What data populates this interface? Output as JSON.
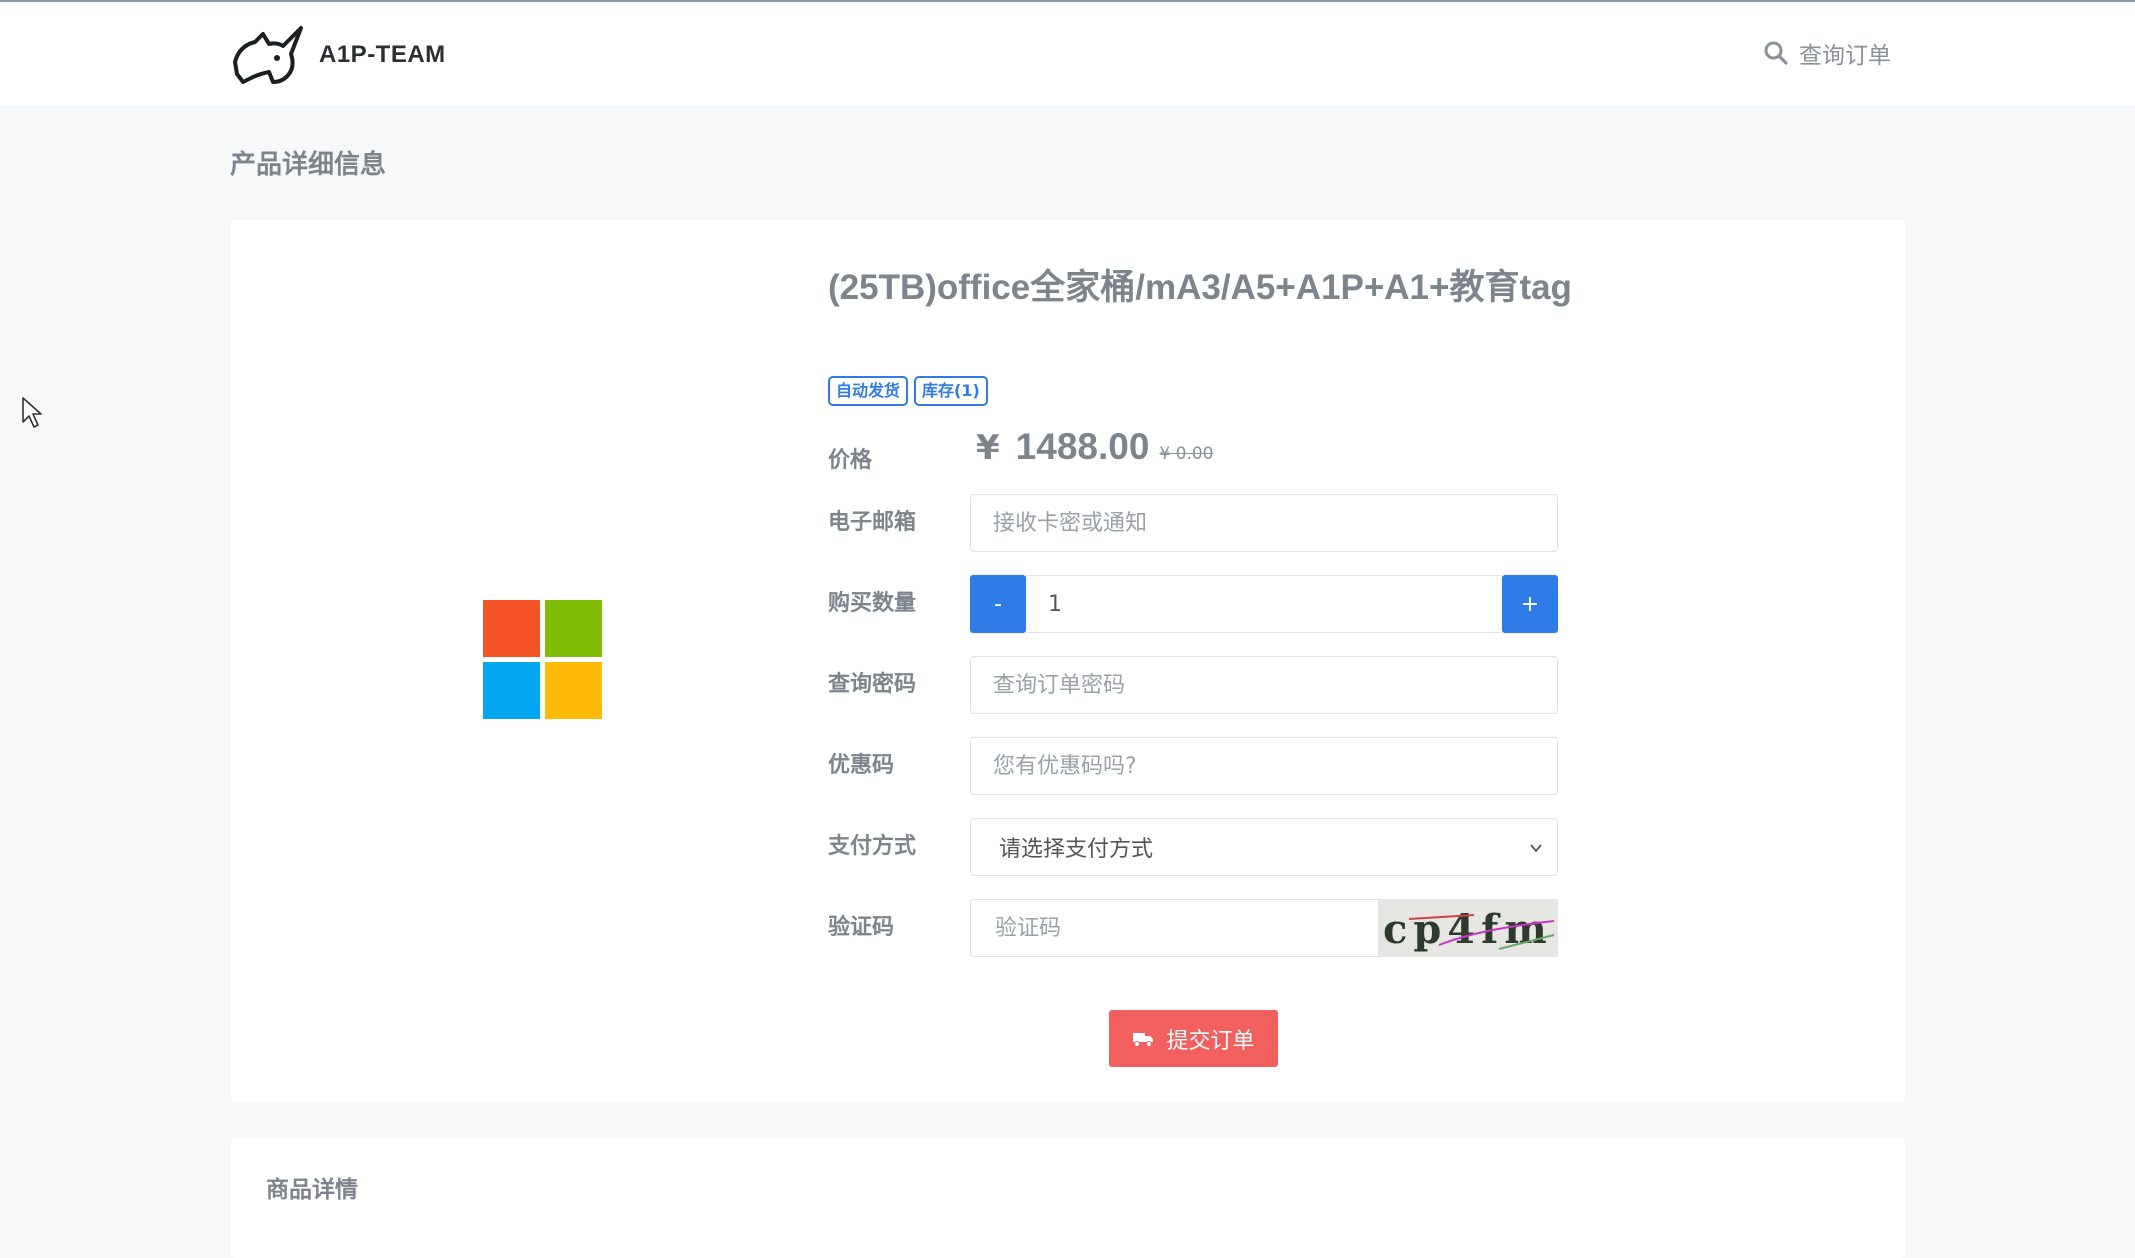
{
  "header": {
    "brand_name": "A1P-TEAM",
    "query_orders_label": "查询订单"
  },
  "page": {
    "heading": "产品详细信息"
  },
  "product": {
    "title": "(25TB)office全家桶/mA3/A5+A1P+A1+教育tag",
    "badges": [
      "自动发货",
      "库存(1)"
    ],
    "image_icon": "microsoft-logo-icon",
    "price_label": "价格",
    "currency": "¥",
    "price": "1488.00",
    "original_price": "¥ 0.00"
  },
  "form": {
    "email_label": "电子邮箱",
    "email_placeholder": "接收卡密或通知",
    "quantity_label": "购买数量",
    "quantity_value": "1",
    "minus": "-",
    "plus": "+",
    "password_label": "查询密码",
    "password_placeholder": "查询订单密码",
    "coupon_label": "优惠码",
    "coupon_placeholder": "您有优惠码吗?",
    "payment_label": "支付方式",
    "payment_selected": "请选择支付方式",
    "captcha_label": "验证码",
    "captcha_placeholder": "验证码",
    "captcha_text": "cp4fm",
    "submit_label": "提交订单"
  },
  "details": {
    "title": "商品详情"
  },
  "colors": {
    "accent_blue": "#2f7be8",
    "submit_red": "#f15f5f",
    "ms_red": "#f35325",
    "ms_green": "#81bc06",
    "ms_blue": "#05a6f0",
    "ms_yellow": "#ffba08"
  }
}
